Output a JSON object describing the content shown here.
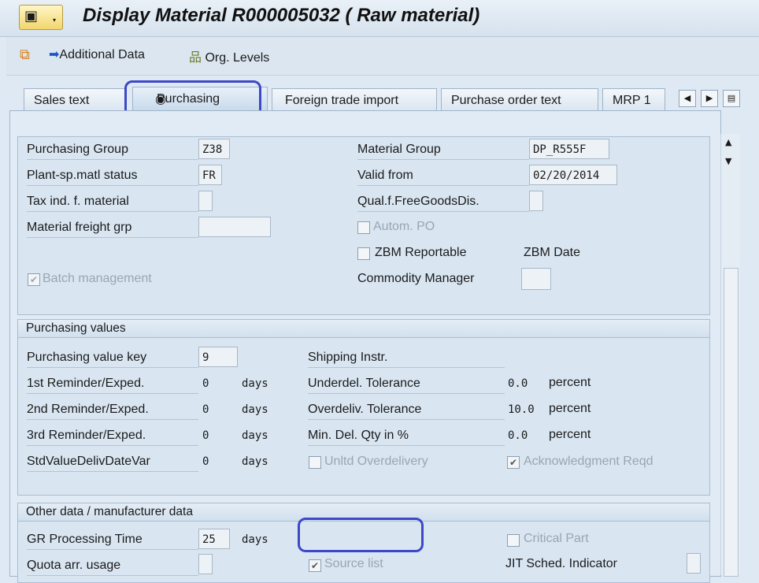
{
  "title": "Display Material R000005032 (      Raw material)",
  "toolbar": {
    "additional_data": "Additional Data",
    "org_levels": "Org. Levels"
  },
  "tabs": [
    "Sales text",
    "Purchasing",
    "Foreign trade import",
    "Purchase order text",
    "MRP 1"
  ],
  "general": {
    "purchasing_group": {
      "label": "Purchasing Group",
      "value": "Z38"
    },
    "plant_status": {
      "label": "Plant-sp.matl status",
      "value": "FR"
    },
    "tax_ind": {
      "label": "Tax ind. f. material",
      "value": ""
    },
    "freight_grp": {
      "label": "Material freight grp",
      "value": ""
    },
    "batch_mgmt": {
      "label": "Batch management",
      "checked": true
    },
    "material_group": {
      "label": "Material Group",
      "value": "DP_R555F"
    },
    "valid_from": {
      "label": "Valid from",
      "value": "02/20/2014"
    },
    "qual_free_goods": {
      "label": "Qual.f.FreeGoodsDis.",
      "value": ""
    },
    "autom_po": {
      "label": "Autom. PO",
      "checked": false
    },
    "zbm_reportable": {
      "label": "ZBM Reportable",
      "checked": false
    },
    "zbm_date": {
      "label": "ZBM Date"
    },
    "commodity_manager": {
      "label": "Commodity Manager",
      "value": ""
    }
  },
  "purchasing_values": {
    "title": "Purchasing values",
    "value_key": {
      "label": "Purchasing value key",
      "value": "9"
    },
    "reminder1": {
      "label": "1st Reminder/Exped.",
      "value": "0",
      "unit": "days"
    },
    "reminder2": {
      "label": "2nd Reminder/Exped.",
      "value": "0",
      "unit": "days"
    },
    "reminder3": {
      "label": "3rd Reminder/Exped.",
      "value": "0",
      "unit": "days"
    },
    "std_value": {
      "label": "StdValueDelivDateVar",
      "value": "0",
      "unit": "days"
    },
    "shipping_instr": {
      "label": "Shipping Instr.",
      "value": ""
    },
    "underdel": {
      "label": "Underdel. Tolerance",
      "value": "0.0",
      "unit": "percent"
    },
    "overdel": {
      "label": "Overdeliv. Tolerance",
      "value": "10.0",
      "unit": "percent"
    },
    "min_del": {
      "label": "Min. Del. Qty in %",
      "value": "0.0",
      "unit": "percent"
    },
    "unltd_overdel": {
      "label": "Unltd Overdelivery",
      "checked": false
    },
    "ack_reqd": {
      "label": "Acknowledgment Reqd",
      "checked": true
    }
  },
  "other_data": {
    "title": "Other data / manufacturer data",
    "gr_time": {
      "label": "GR Processing Time",
      "value": "25",
      "unit": "days"
    },
    "quota": {
      "label": "Quota arr. usage",
      "value": ""
    },
    "source_list": {
      "label": "Source list",
      "checked": true
    },
    "critical_part": {
      "label": "Critical Part",
      "checked": false
    },
    "jit": {
      "label": "JIT Sched. Indicator",
      "value": ""
    }
  }
}
